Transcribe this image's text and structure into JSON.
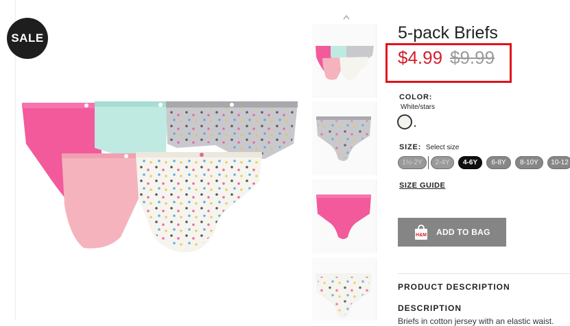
{
  "badge": {
    "text": "SALE"
  },
  "product": {
    "title": "5-pack Briefs",
    "price_sale": "$4.99",
    "price_original": "$9.99",
    "color_label": "COLOR:",
    "color_value": "White/stars",
    "size_label": "SIZE:",
    "size_hint": "Select size",
    "sizes": [
      {
        "label": "1½-2Y",
        "state": "disabled"
      },
      {
        "label": "2-4Y",
        "state": "disabled"
      },
      {
        "label": "4-6Y",
        "state": "selected"
      },
      {
        "label": "6-8Y",
        "state": "available"
      },
      {
        "label": "8-10Y",
        "state": "available"
      },
      {
        "label": "10-12",
        "state": "available"
      }
    ],
    "size_guide": "SIZE GUIDE",
    "add_to_bag": "ADD TO BAG",
    "bag_icon_text": "H&M",
    "description_heading": "PRODUCT DESCRIPTION",
    "description_sub": "DESCRIPTION",
    "description_text": "Briefs in cotton jersey with an elastic waist."
  },
  "thumbnails": [
    {
      "name": "all-five-briefs"
    },
    {
      "name": "grey-star-briefs"
    },
    {
      "name": "pink-briefs"
    },
    {
      "name": "white-star-briefs"
    }
  ],
  "colors": {
    "sale_red": "#d31f2c",
    "highlight_box": "#e0121b",
    "button_gray": "#858585",
    "badge_black": "#1e1e1e"
  }
}
